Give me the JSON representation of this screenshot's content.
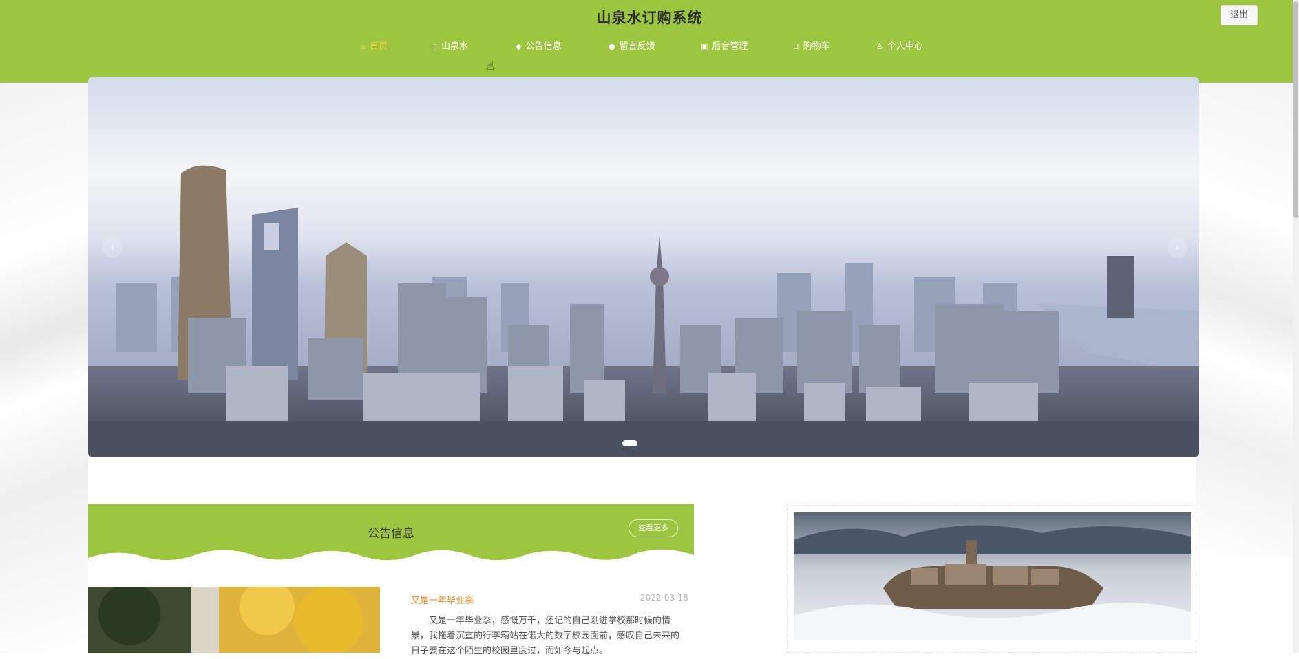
{
  "header": {
    "site_title": "山泉水订购系统",
    "logout_label": "退出",
    "background_color": "#9cc640"
  },
  "nav": {
    "items": [
      {
        "label": "首页",
        "icon": "home-icon",
        "active": true
      },
      {
        "label": "山泉水",
        "icon": "bottle-icon",
        "active": false
      },
      {
        "label": "公告信息",
        "icon": "bell-icon",
        "active": false
      },
      {
        "label": "留言反馈",
        "icon": "chat-icon",
        "active": false
      },
      {
        "label": "后台管理",
        "icon": "dashboard-icon",
        "active": false
      },
      {
        "label": "购物车",
        "icon": "cart-icon",
        "active": false
      },
      {
        "label": "个人中心",
        "icon": "user-icon",
        "active": false
      }
    ],
    "active_color": "#f3d23b"
  },
  "banner": {
    "image": "city-skyline-photo",
    "slide_count": 1,
    "active_slide": 1
  },
  "notice": {
    "section_title": "公告信息",
    "more_label": "查看更多",
    "items": [
      {
        "title": "又是一年毕业季",
        "date": "2022-03-18",
        "excerpt": "又是一年毕业季，感慨万千，还记的自己刚进学校那时候的情景，我拖着沉重的行李箱站在偌大的数字校园面前，感叹自己未来的日子要在这个陌生的校园里度过，而如今与起点。"
      }
    ]
  },
  "side_card": {
    "image": "castle-in-clouds-photo"
  }
}
